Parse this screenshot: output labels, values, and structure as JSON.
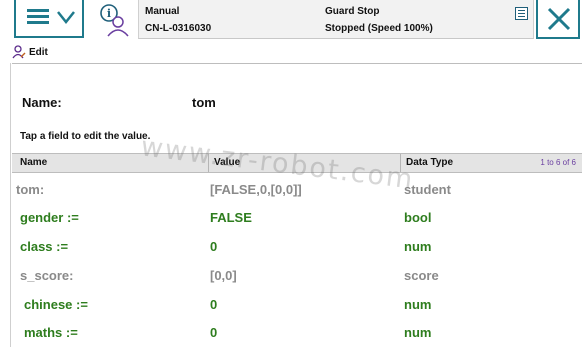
{
  "status": {
    "mode": "Manual",
    "controller": "CN-L-0316030",
    "guard_state": "Guard Stop",
    "speed_state": "Stopped (Speed 100%)"
  },
  "menu": {
    "edit_label": "Edit"
  },
  "record": {
    "name_label": "Name:",
    "name_value": "tom",
    "hint": "Tap a field to edit the value."
  },
  "table": {
    "headers": {
      "name": "Name",
      "value": "Value",
      "type": "Data Type"
    },
    "pager": "1 to 6 of 6",
    "rows": [
      {
        "name": "tom:",
        "value": "[FALSE,0,[0,0]]",
        "type": "student",
        "style": "grey"
      },
      {
        "name": "gender :=",
        "value": "FALSE",
        "type": "bool",
        "style": "green"
      },
      {
        "name": "class :=",
        "value": "0",
        "type": "num",
        "style": "green"
      },
      {
        "name": "s_score:",
        "value": "[0,0]",
        "type": "score",
        "style": "grey"
      },
      {
        "name": "chinese :=",
        "value": "0",
        "type": "num",
        "style": "green"
      },
      {
        "name": "maths :=",
        "value": "0",
        "type": "num",
        "style": "green"
      }
    ]
  },
  "watermark": "www.zr-robot.com",
  "colors": {
    "frame_teal": "#1f7a8c",
    "editable_green": "#2e7d1e",
    "readonly_grey": "#8a8a8a",
    "header_bg": "#e4e4e4",
    "pager_purple": "#6a3fa0"
  },
  "icons": [
    "hamburger-menu-icon",
    "chevron-down-icon",
    "user-info-icon",
    "program-window-icon",
    "close-icon",
    "edit-user-icon"
  ]
}
